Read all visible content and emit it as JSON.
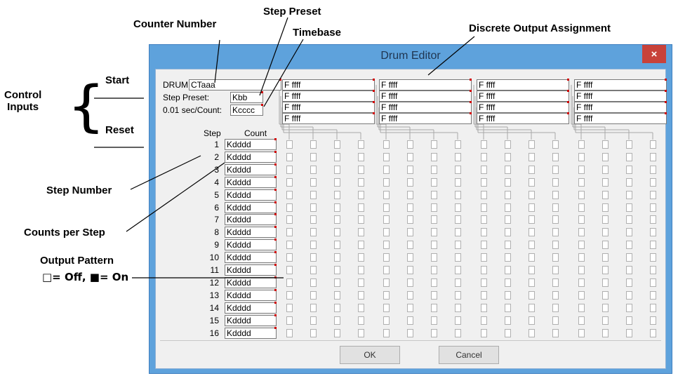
{
  "annotations": {
    "counter_number": "Counter Number",
    "step_preset": "Step Preset",
    "timebase": "Timebase",
    "discrete_output_assignment": "Discrete Output Assignment",
    "start": "Start",
    "control_inputs": "Control\nInputs",
    "reset": "Reset",
    "step_number": "Step Number",
    "counts_per_step": "Counts per Step",
    "output_pattern_line1": "Output Pattern",
    "output_pattern_line2": "□= Off, ■= On",
    "brace": "{"
  },
  "window": {
    "title": "Drum Editor",
    "close_icon": "close-icon",
    "close_glyph": "×"
  },
  "drum": {
    "drum_label": "DRUM",
    "counter_value": "CTaaa",
    "step_preset_label": "Step Preset:",
    "step_preset_value": "Kbb",
    "timebase_label": "0.01 sec/Count:",
    "timebase_value": "Kcccc"
  },
  "outputs": {
    "groups": [
      [
        "F ffff",
        "F ffff",
        "F ffff",
        "F ffff"
      ],
      [
        "F ffff",
        "F ffff",
        "F ffff",
        "F ffff"
      ],
      [
        "F ffff",
        "F ffff",
        "F ffff",
        "F ffff"
      ],
      [
        "F ffff",
        "F ffff",
        "F ffff",
        "F ffff"
      ]
    ]
  },
  "steps": {
    "step_header": "Step",
    "count_header": "Count",
    "rows": [
      {
        "step": "1",
        "count": "Kdddd"
      },
      {
        "step": "2",
        "count": "Kdddd"
      },
      {
        "step": "3",
        "count": "Kdddd"
      },
      {
        "step": "4",
        "count": "Kdddd"
      },
      {
        "step": "5",
        "count": "Kdddd"
      },
      {
        "step": "6",
        "count": "Kdddd"
      },
      {
        "step": "7",
        "count": "Kdddd"
      },
      {
        "step": "8",
        "count": "Kdddd"
      },
      {
        "step": "9",
        "count": "Kdddd"
      },
      {
        "step": "10",
        "count": "Kdddd"
      },
      {
        "step": "11",
        "count": "Kdddd"
      },
      {
        "step": "12",
        "count": "Kdddd"
      },
      {
        "step": "13",
        "count": "Kdddd"
      },
      {
        "step": "14",
        "count": "Kdddd"
      },
      {
        "step": "15",
        "count": "Kdddd"
      },
      {
        "step": "16",
        "count": "Kdddd"
      }
    ],
    "pattern": "all-off"
  },
  "buttons": {
    "ok": "OK",
    "cancel": "Cancel"
  },
  "colors": {
    "window_frame": "#5ea2dc",
    "close_button": "#c8423a",
    "client_bg": "#f0f0f0",
    "required_marker": "#d00000"
  }
}
